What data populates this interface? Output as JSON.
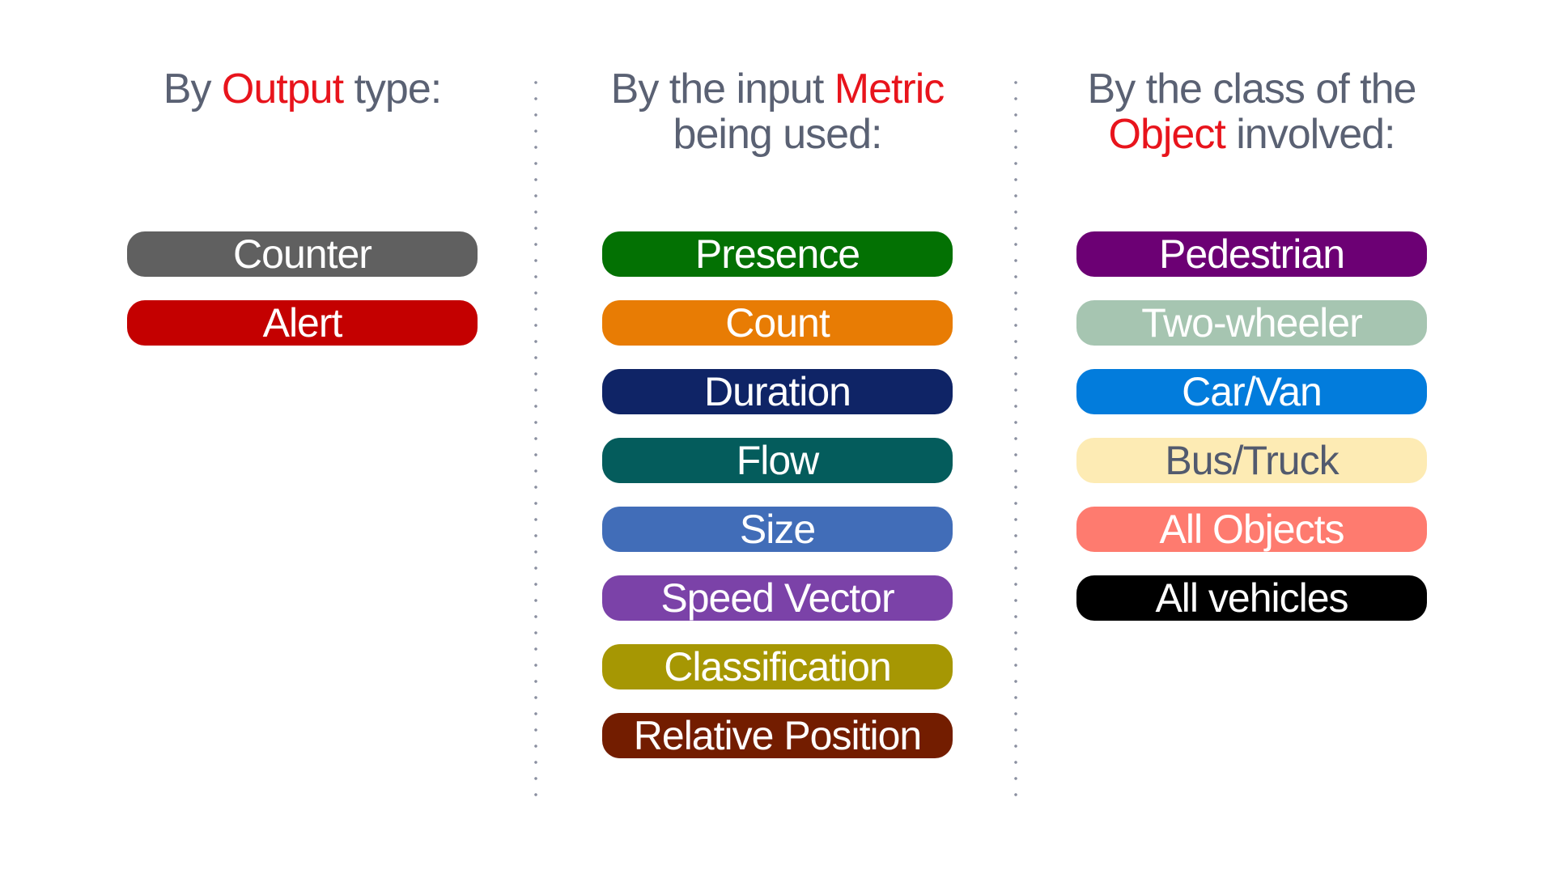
{
  "columns": [
    {
      "id": "output",
      "heading": {
        "line1_pre": "By ",
        "line1_accent": "Output",
        "line1_post": " type:",
        "line2_pre": "",
        "line2_accent": "",
        "line2_post": ""
      },
      "items": [
        {
          "label": "Counter",
          "bg": "#606060",
          "fg": "#ffffff"
        },
        {
          "label": "Alert",
          "bg": "#c40000",
          "fg": "#ffffff"
        }
      ]
    },
    {
      "id": "metric",
      "heading": {
        "line1_pre": "By the input ",
        "line1_accent": "Metric",
        "line1_post": "",
        "line2_pre": "being used:",
        "line2_accent": "",
        "line2_post": ""
      },
      "items": [
        {
          "label": "Presence",
          "bg": "#037103",
          "fg": "#ffffff"
        },
        {
          "label": "Count",
          "bg": "#e87c04",
          "fg": "#ffffff"
        },
        {
          "label": "Duration",
          "bg": "#0f2466",
          "fg": "#ffffff"
        },
        {
          "label": "Flow",
          "bg": "#045c5c",
          "fg": "#ffffff"
        },
        {
          "label": "Size",
          "bg": "#416db8",
          "fg": "#ffffff"
        },
        {
          "label": "Speed Vector",
          "bg": "#7b42a8",
          "fg": "#ffffff"
        },
        {
          "label": "Classification",
          "bg": "#a69703",
          "fg": "#ffffff"
        },
        {
          "label": "Relative Position",
          "bg": "#731d00",
          "fg": "#ffffff"
        }
      ]
    },
    {
      "id": "object",
      "heading": {
        "line1_pre": "By the class of the",
        "line1_accent": "",
        "line1_post": "",
        "line2_pre": "",
        "line2_accent": "Object",
        "line2_post": " involved:"
      },
      "items": [
        {
          "label": "Pedestrian",
          "bg": "#6c0074",
          "fg": "#ffffff"
        },
        {
          "label": "Two-wheeler",
          "bg": "#a6c5b1",
          "fg": "#ffffff"
        },
        {
          "label": "Car/Van",
          "bg": "#027cdc",
          "fg": "#ffffff"
        },
        {
          "label": "Bus/Truck",
          "bg": "#fdebb4",
          "fg": "#525a6e"
        },
        {
          "label": "All Objects",
          "bg": "#fe7b6f",
          "fg": "#ffffff"
        },
        {
          "label": "All vehicles",
          "bg": "#000000",
          "fg": "#ffffff"
        }
      ]
    }
  ],
  "colors": {
    "heading_text": "#5a6173",
    "accent_red": "#e8141c",
    "divider_dots": "#8a8fa0"
  }
}
